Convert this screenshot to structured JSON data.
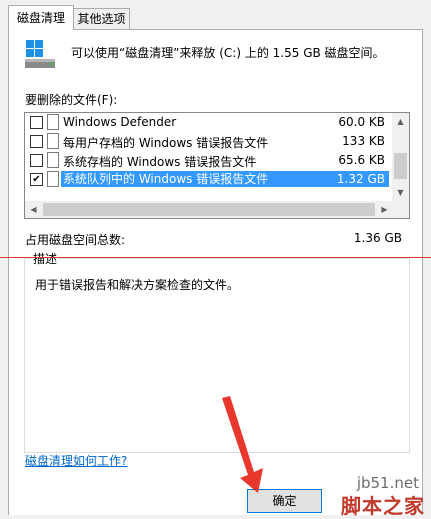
{
  "tabs": [
    {
      "label": "磁盘清理"
    },
    {
      "label": "其他选项"
    }
  ],
  "intro_text": "可以使用“磁盘清理”来释放  (C:) 上的 1.55 GB 磁盘空间。",
  "files_label": "要删除的文件(F):",
  "files": [
    {
      "checked": false,
      "name": "Windows Defender",
      "size": "60.0 KB"
    },
    {
      "checked": false,
      "name": "每用户存档的 Windows 错误报告文件",
      "size": "133 KB"
    },
    {
      "checked": false,
      "name": "系统存档的 Windows 错误报告文件",
      "size": "65.6 KB"
    },
    {
      "checked": true,
      "name": "系统队列中的 Windows 错误报告文件",
      "size": "1.32 GB"
    }
  ],
  "total": {
    "label": "占用磁盘空间总数:",
    "value": "1.36 GB"
  },
  "description": {
    "title": "描述",
    "text": "用于错误报告和解决方案检查的文件。"
  },
  "help_link": "磁盘清理如何工作?",
  "ok_button": "确定",
  "watermark": {
    "site": "jb51.net",
    "name": "脚本之家"
  },
  "colors": {
    "selection": "#3399ff",
    "link": "#0066cc",
    "arrow": "#e8372d"
  }
}
